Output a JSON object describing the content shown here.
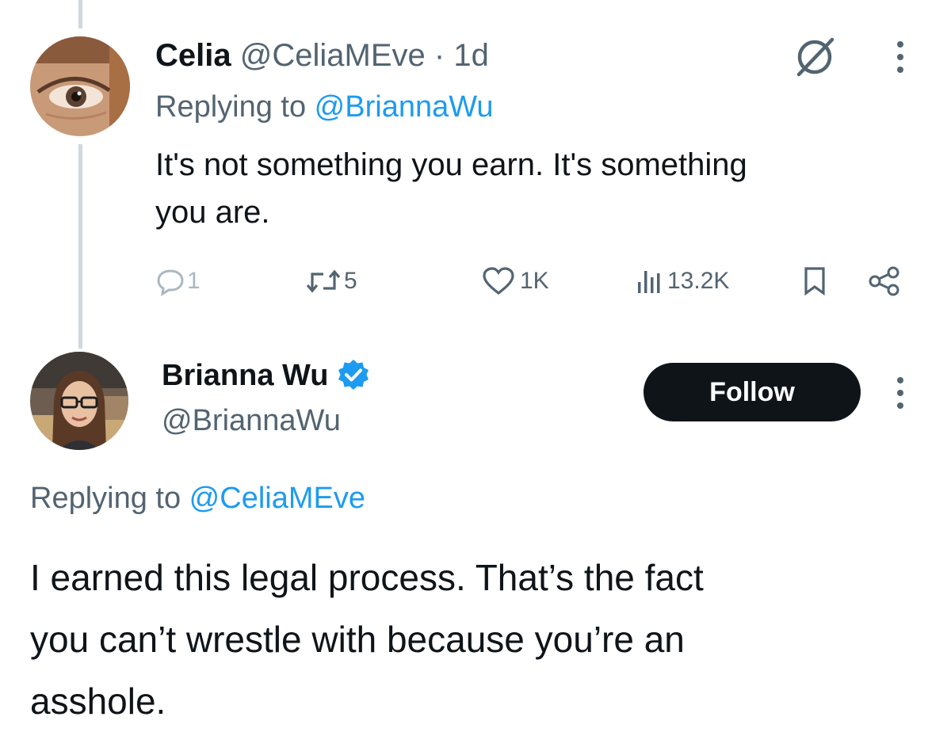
{
  "colors": {
    "accent": "#1d9bf0",
    "text": "#0f1419",
    "muted": "#536471",
    "button_bg": "#0f1419"
  },
  "tweet1": {
    "name": "Celia",
    "handle": "@CeliaMEve",
    "separator": "·",
    "time": "1d",
    "replying_prefix": "Replying to ",
    "replying_to": "@BriannaWu",
    "text_line1": "It's not something you earn. It's something",
    "text_line2": "you are.",
    "actions": {
      "replies": "1",
      "reposts": "5",
      "likes": "1K",
      "views": "13.2K"
    },
    "icons": [
      "grok-icon",
      "more-icon",
      "reply-icon",
      "repost-icon",
      "like-icon",
      "views-icon",
      "bookmark-icon",
      "share-icon"
    ]
  },
  "tweet2": {
    "name": "Brianna Wu",
    "handle": "@BriannaWu",
    "verified": true,
    "follow_label": "Follow",
    "replying_prefix": "Replying to ",
    "replying_to": "@CeliaMEve",
    "text_line1": "I earned this legal process. That’s the fact",
    "text_line2": "you can’t wrestle with because you’re an",
    "text_line3": "asshole.",
    "icons": [
      "verified-badge-icon",
      "more-icon"
    ]
  }
}
